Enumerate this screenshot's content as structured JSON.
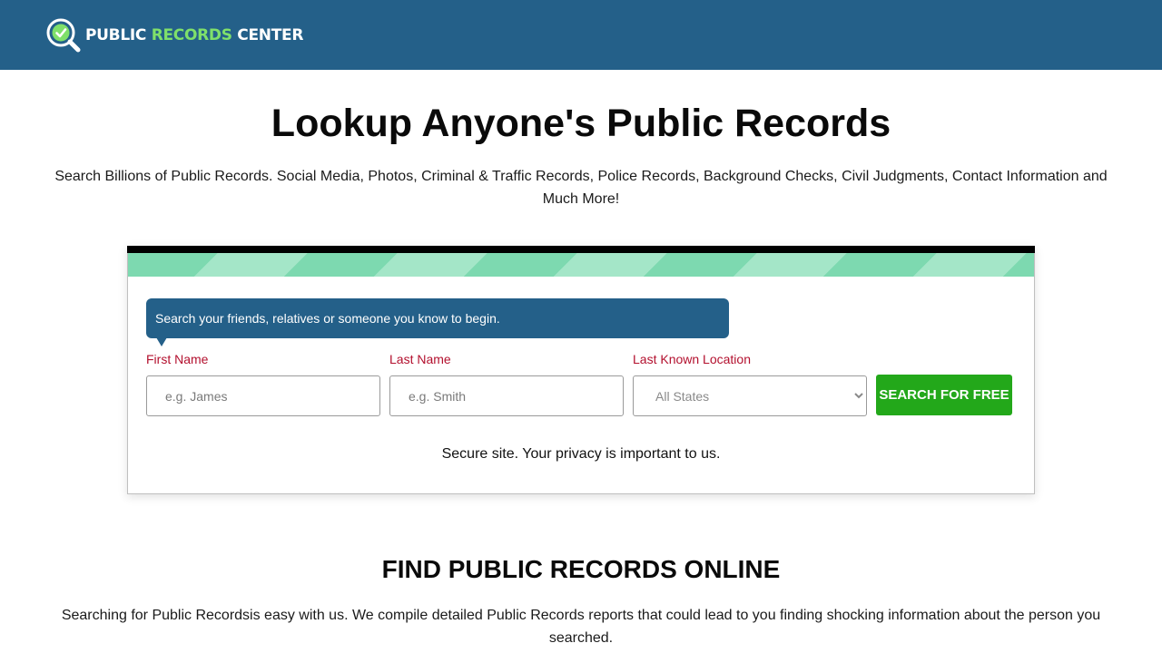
{
  "header": {
    "logo_word1": "PUBLIC",
    "logo_word2": "RECORDS",
    "logo_word3": "CENTER",
    "bg_color": "#246089",
    "accent_color": "#7fe06a",
    "logo_icon": "magnifier-check-icon"
  },
  "hero": {
    "title": "Lookup Anyone's Public Records",
    "subtitle": "Search Billions of Public Records. Social Media, Photos, Criminal & Traffic Records, Police Records, Background Checks, Civil Judgments, Contact Information and Much More!"
  },
  "search_form": {
    "prompt": "Search your friends, relatives or someone you know to begin.",
    "first_name_label": "First Name",
    "first_name_placeholder": "e.g. James",
    "first_name_value": "",
    "last_name_label": "Last Name",
    "last_name_placeholder": "e.g. Smith",
    "last_name_value": "",
    "location_label": "Last Known Location",
    "location_selected": "All States",
    "submit_label": "SEARCH FOR FREE",
    "submit_color": "#23a81a",
    "secure_note": "Secure site. Your privacy is important to us."
  },
  "info_section": {
    "title": "FIND PUBLIC RECORDS ONLINE",
    "body": "Searching for Public Recordsis easy with us. We compile detailed Public Records reports that could lead to you finding shocking information about the person you searched."
  }
}
